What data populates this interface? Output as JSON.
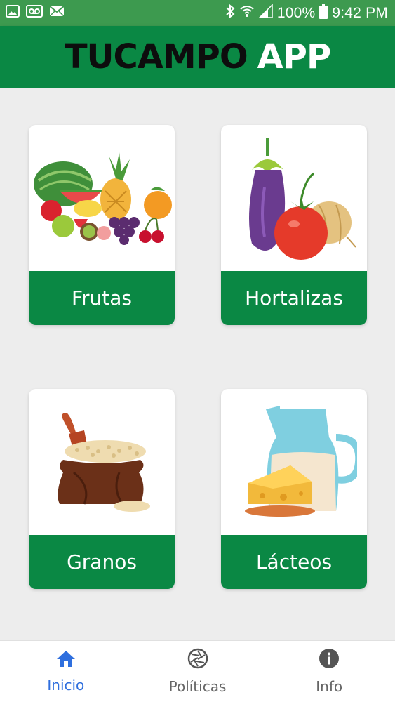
{
  "status_bar": {
    "battery": "100%",
    "time": "9:42 PM",
    "left_icons": [
      "image-icon",
      "voicemail-icon",
      "mail-icon"
    ],
    "right_icons": [
      "bluetooth-icon",
      "wifi-icon",
      "signal-icon",
      "battery-icon"
    ]
  },
  "header": {
    "title_part1": "TUCAMPO",
    "title_part2": "APP"
  },
  "categories": [
    {
      "label": "Frutas",
      "icon": "fruits-icon"
    },
    {
      "label": "Hortalizas",
      "icon": "vegetables-icon"
    },
    {
      "label": "Granos",
      "icon": "grain-sack-icon"
    },
    {
      "label": "Lácteos",
      "icon": "milk-cheese-icon"
    }
  ],
  "bottom_nav": {
    "items": [
      {
        "label": "Inicio",
        "icon": "home-icon",
        "active": true
      },
      {
        "label": "Políticas",
        "icon": "aperture-icon",
        "active": false
      },
      {
        "label": "Info",
        "icon": "info-icon",
        "active": false
      }
    ]
  },
  "colors": {
    "status_bar": "#3d9a4f",
    "header": "#0a8844",
    "card_label_bg": "#0a8844",
    "active_nav": "#2f6fde",
    "inactive_nav": "#666666",
    "background": "#ededed"
  }
}
